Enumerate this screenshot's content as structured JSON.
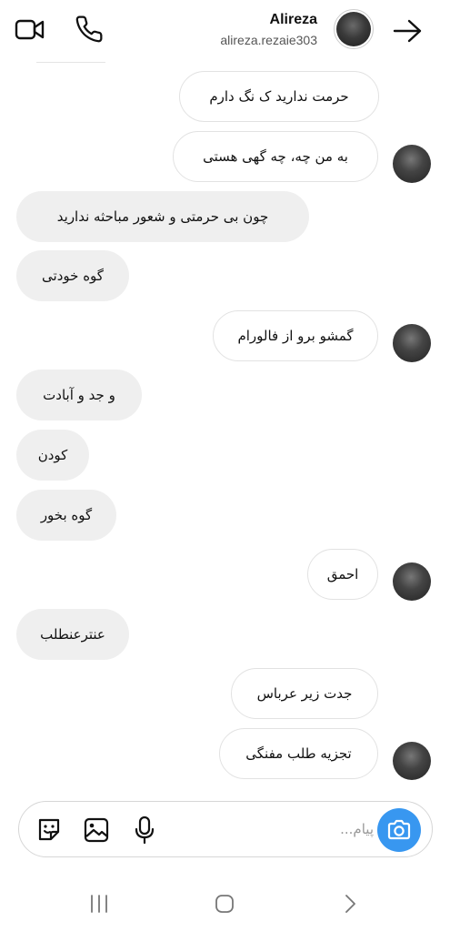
{
  "header": {
    "name": "Alireza",
    "username": "alireza.rezaie303",
    "icons": {
      "video": "video-call-icon",
      "phone": "voice-call-icon",
      "back": "back-arrow-icon"
    }
  },
  "messages": [
    {
      "side": "sent",
      "text": "حرمت ندارید ک نگ دارم",
      "avatar": false
    },
    {
      "side": "sent",
      "text": "به من چه، چه گهی هستی",
      "avatar": true
    },
    {
      "side": "received",
      "text": "چون بی حرمتی و شعور مباحثه ندارید"
    },
    {
      "side": "received",
      "text": "گوه خودتی"
    },
    {
      "side": "sent",
      "text": "گمشو برو از فالورام",
      "avatar": true
    },
    {
      "side": "received",
      "text": "و جد و آبادت"
    },
    {
      "side": "received",
      "text": "کودن"
    },
    {
      "side": "received",
      "text": "گوه بخور"
    },
    {
      "side": "sent",
      "text": "احمق",
      "avatar": true
    },
    {
      "side": "received",
      "text": "عنترعنطلب"
    },
    {
      "side": "sent",
      "text": "جدت زیر عرباس",
      "avatar": false
    },
    {
      "side": "sent",
      "text": "تجزیه طلب مفنگی",
      "avatar": true
    }
  ],
  "composer": {
    "placeholder": "پیام...",
    "icons": [
      "sticker-icon",
      "gallery-icon",
      "microphone-icon",
      "camera-icon"
    ],
    "camera_color": "#3897f0"
  },
  "navbar": {
    "icons": [
      "recent-apps-icon",
      "home-icon",
      "back-icon"
    ]
  }
}
